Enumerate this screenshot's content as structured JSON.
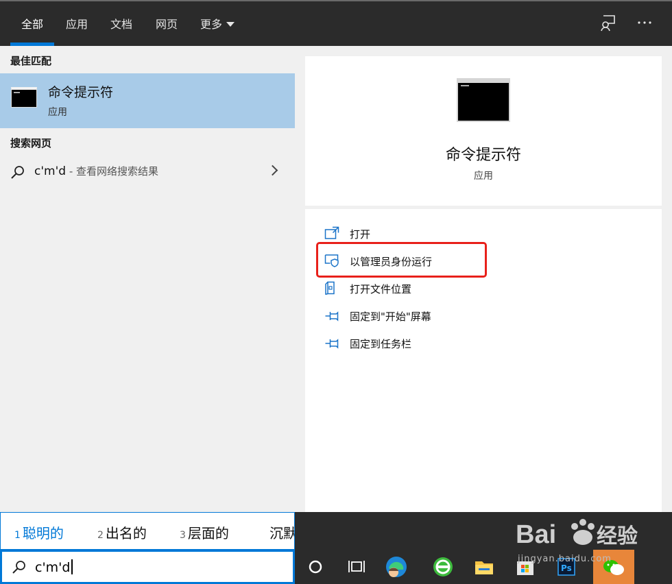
{
  "tabs": [
    {
      "label": "全部"
    },
    {
      "label": "应用"
    },
    {
      "label": "文档"
    },
    {
      "label": "网页"
    },
    {
      "label": "更多"
    }
  ],
  "left": {
    "best_match_title": "最佳匹配",
    "best_match": {
      "name": "命令提示符",
      "type": "应用"
    },
    "web_title": "搜索网页",
    "web_result": {
      "query": "c'm'd",
      "sub": " - 查看网络搜索结果"
    }
  },
  "right": {
    "app_name": "命令提示符",
    "app_type": "应用",
    "actions": [
      {
        "label": "打开",
        "icon": "open-window-icon"
      },
      {
        "label": "以管理员身份运行",
        "icon": "shield-window-icon"
      },
      {
        "label": "打开文件位置",
        "icon": "file-location-icon"
      },
      {
        "label": "固定到\"开始\"屏幕",
        "icon": "pin-icon"
      },
      {
        "label": "固定到任务栏",
        "icon": "pin-icon"
      }
    ]
  },
  "ime": {
    "candidates": [
      {
        "num": "1",
        "text": "聪明的"
      },
      {
        "num": "2",
        "text": "出名的"
      },
      {
        "num": "3",
        "text": "层面的"
      },
      {
        "num": "",
        "text": "沉默"
      }
    ]
  },
  "search": {
    "value": "c'm'd"
  },
  "watermark": {
    "brand": "Bai",
    "brand2": "经验",
    "url": "jingyan.baidu.com"
  },
  "colors": {
    "accent": "#0078d7",
    "highlight": "#e8201a",
    "selected": "#a8cbe8"
  }
}
